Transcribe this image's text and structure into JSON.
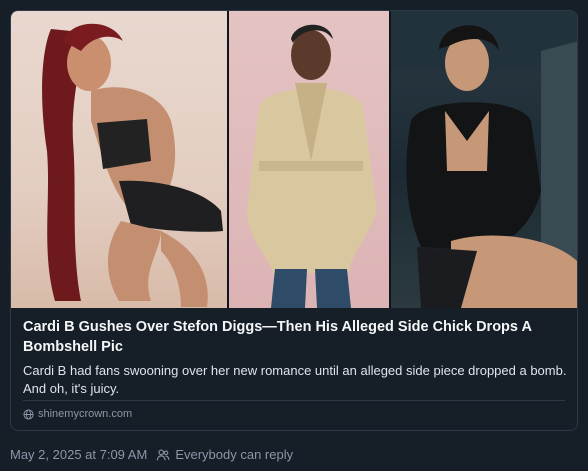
{
  "card": {
    "headline": "Cardi B Gushes Over Stefon Diggs—Then His Alleged Side Chick Drops A Bombshell Pic",
    "description": "Cardi B had fans swooning over her new romance until an alleged side piece dropped a bomb. And oh, it's juicy.",
    "source": "shinemycrown.com",
    "source_icon": "globe-icon"
  },
  "post_meta": {
    "timestamp": "May 2, 2025 at 7:09 AM",
    "audience_icon": "people-icon",
    "audience": "Everybody can reply"
  },
  "colors": {
    "background": "#161e27",
    "border": "#2e3a48",
    "muted_text": "#8b98a8"
  }
}
